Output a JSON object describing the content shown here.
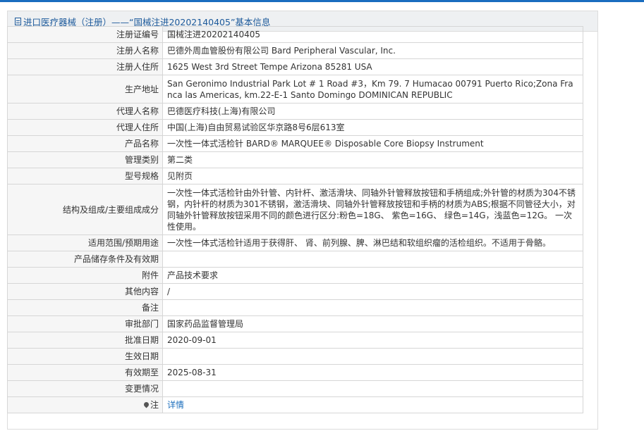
{
  "panel": {
    "title": "进口医疗器械（注册）——“国械注进20202140405”基本信息"
  },
  "rows": [
    {
      "label": "注册证编号",
      "value": "国械注进20202140405"
    },
    {
      "label": "注册人名称",
      "value": "巴德外周血管股份有限公司 Bard Peripheral Vascular, Inc."
    },
    {
      "label": "注册人住所",
      "value": "1625 West 3rd Street Tempe Arizona 85281 USA"
    },
    {
      "label": "生产地址",
      "value": "San Geronimo Industrial Park Lot # 1 Road #3，Km 79. 7 Humacao 00791 Puerto Rico;Zona Franca las Americas, km.22-E-1 Santo Domingo DOMINICAN REPUBLIC"
    },
    {
      "label": "代理人名称",
      "value": "巴德医疗科技(上海)有限公司"
    },
    {
      "label": "代理人住所",
      "value": "中国(上海)自由贸易试验区华京路8号6层613室"
    },
    {
      "label": "产品名称",
      "value": "一次性一体式活检针 BARD® MARQUEE® Disposable Core Biopsy Instrument"
    },
    {
      "label": "管理类别",
      "value": "第二类"
    },
    {
      "label": "型号规格",
      "value": "见附页"
    },
    {
      "label": "结构及组成/主要组成成分",
      "value": "一次性一体式活检针由外针管、内针杆、激活滑块、同轴外针管释放按钮和手柄组成;外针管的材质为304不锈钢，内针杆的材质为301不锈钢，激活滑块、同轴外针管释放按钮和手柄的材质为ABS;根据不同管径大小，对同轴外针管释放按钮采用不同的颜色进行区分:粉色=18G、 紫色=16G、 绿色=14G，浅蓝色=12G。 一次性使用。"
    },
    {
      "label": "适用范围/预期用途",
      "value": "一次性一体式活检针适用于获得肝、 肾、前列腺、脾、淋巴结和软组织瘤的活检组织。不适用于骨骼。"
    },
    {
      "label": "产品储存条件及有效期",
      "value": ""
    },
    {
      "label": "附件",
      "value": "产品技术要求"
    },
    {
      "label": "其他内容",
      "value": "/"
    },
    {
      "label": "备注",
      "value": ""
    },
    {
      "label": "审批部门",
      "value": "国家药品监督管理局"
    },
    {
      "label": "批准日期",
      "value": "2020-09-01"
    },
    {
      "label": "生效日期",
      "value": ""
    },
    {
      "label": "有效期至",
      "value": "2025-08-31"
    },
    {
      "label": "变更情况",
      "value": ""
    },
    {
      "label": "注",
      "value": "详情"
    }
  ],
  "icons": {
    "title_icon": "document-icon",
    "note_icon": "pin-icon"
  },
  "colors": {
    "accent": "#1d5a9b",
    "link": "#1d6fbd",
    "top_rule": "#1a6dbf",
    "header_bg": "#eef0f2",
    "label_bg": "#f6f6f6",
    "border": "#d6d6d6"
  }
}
